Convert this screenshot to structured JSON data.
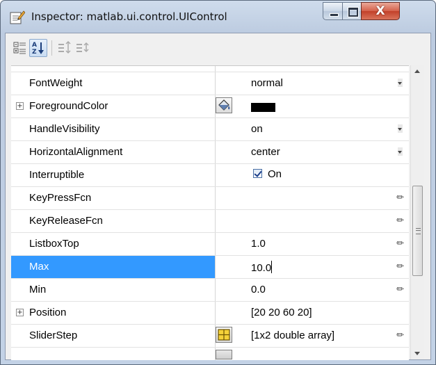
{
  "window": {
    "title": "Inspector:  matlab.ui.control.UIControl",
    "icon": "inspector-icon",
    "controls": {
      "minimize": "minimize-icon",
      "maximize": "maximize-icon",
      "close": "X"
    }
  },
  "toolbar": {
    "buttons": [
      {
        "name": "categorized-view",
        "icon": "categorized-icon",
        "active": false
      },
      {
        "name": "alphabetical-sort",
        "icon": "sort-az-icon",
        "active": true
      },
      {
        "name": "expand-all",
        "icon": "expand-all-icon",
        "active": false
      },
      {
        "name": "collapse-all",
        "icon": "collapse-all-icon",
        "active": false
      }
    ]
  },
  "properties": [
    {
      "name": "FontWeight",
      "value": "normal",
      "editor": "dropdown"
    },
    {
      "name": "ForegroundColor",
      "expander": "+",
      "editor": "color",
      "color": "#000000"
    },
    {
      "name": "HandleVisibility",
      "value": "on",
      "editor": "dropdown"
    },
    {
      "name": "HorizontalAlignment",
      "value": "center",
      "editor": "dropdown"
    },
    {
      "name": "Interruptible",
      "value": "On",
      "editor": "checkbox",
      "checked": true
    },
    {
      "name": "KeyPressFcn",
      "value": "",
      "editor": "text"
    },
    {
      "name": "KeyReleaseFcn",
      "value": "",
      "editor": "text"
    },
    {
      "name": "ListboxTop",
      "value": "1.0",
      "editor": "text"
    },
    {
      "name": "Max",
      "value": "10.0",
      "editor": "text",
      "selected": true
    },
    {
      "name": "Min",
      "value": "0.0",
      "editor": "text"
    },
    {
      "name": "Position",
      "expander": "+",
      "value": "[20 20 60 20]",
      "editor": "none"
    },
    {
      "name": "SliderStep",
      "value": "[1x2  double array]",
      "editor": "array"
    }
  ],
  "colors": {
    "selection": "#3399ff",
    "window_frame": "#c3d2e6",
    "close_button": "#c2412a"
  }
}
